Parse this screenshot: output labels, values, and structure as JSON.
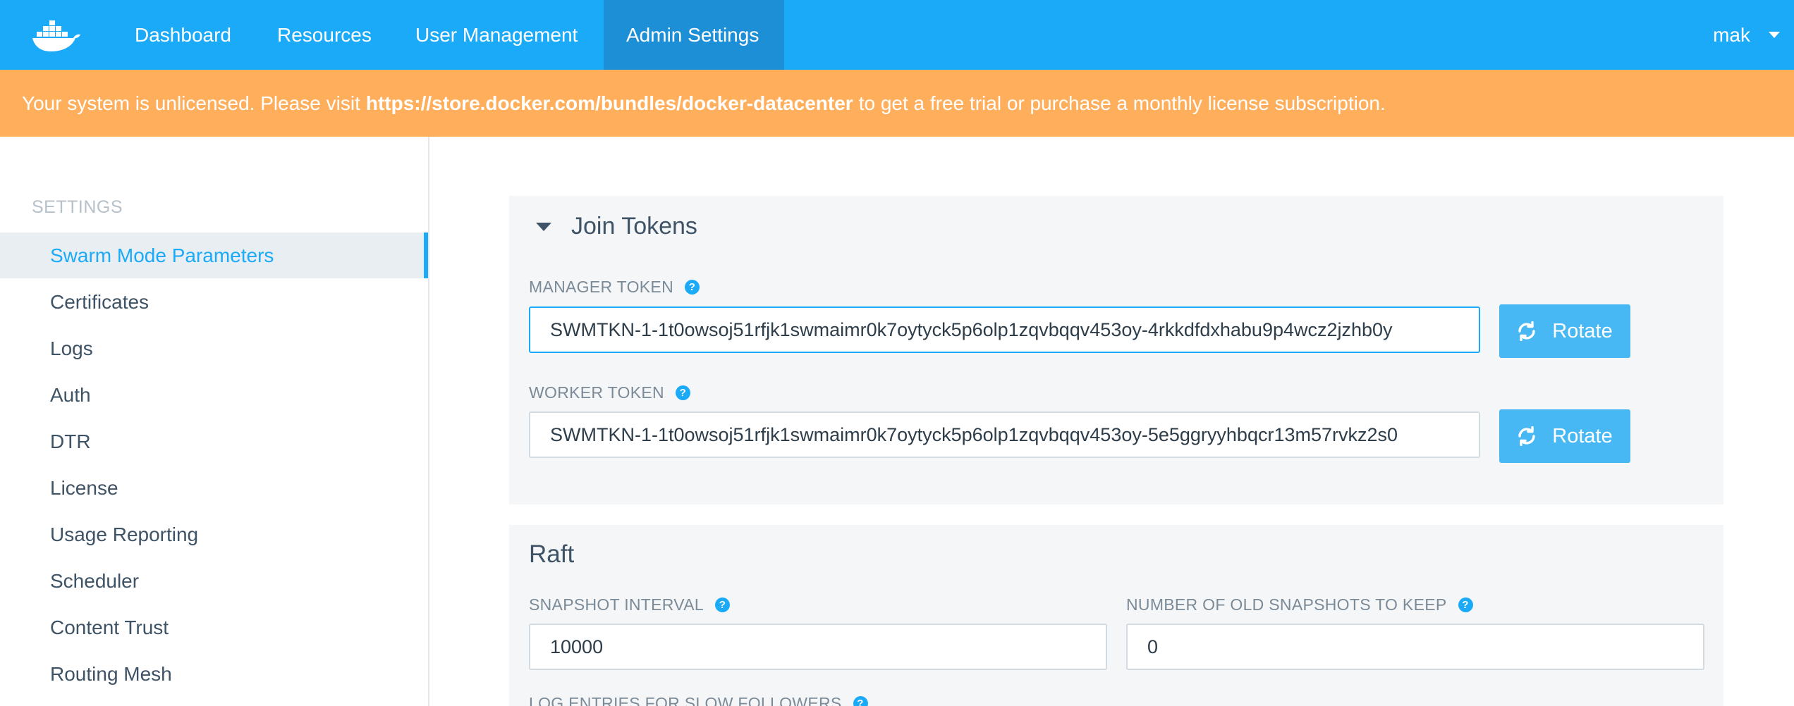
{
  "nav": {
    "logo_icon": "docker-whale-icon",
    "items": [
      {
        "label": "Dashboard"
      },
      {
        "label": "Resources"
      },
      {
        "label": "User Management"
      },
      {
        "label": "Admin Settings",
        "active": true
      }
    ],
    "user": "mak"
  },
  "banner": {
    "prefix": "Your system is unlicensed. Please visit",
    "link": "https://store.docker.com/bundles/docker-datacenter",
    "suffix": "to get a free trial or purchase a monthly license subscription."
  },
  "sidebar": {
    "heading": "SETTINGS",
    "items": [
      {
        "label": "Swarm Mode Parameters",
        "active": true
      },
      {
        "label": "Certificates"
      },
      {
        "label": "Logs"
      },
      {
        "label": "Auth"
      },
      {
        "label": "DTR"
      },
      {
        "label": "License"
      },
      {
        "label": "Usage Reporting"
      },
      {
        "label": "Scheduler"
      },
      {
        "label": "Content Trust"
      },
      {
        "label": "Routing Mesh"
      }
    ]
  },
  "join_tokens": {
    "title": "Join Tokens",
    "manager": {
      "label": "MANAGER TOKEN",
      "value": "SWMTKN-1-1t0owsoj51rfjk1swmaimr0k7oytyck5p6olp1zqvbqqv453oy-4rkkdfdxhabu9p4wcz2jzhb0y",
      "button": "Rotate"
    },
    "worker": {
      "label": "WORKER TOKEN",
      "value": "SWMTKN-1-1t0owsoj51rfjk1swmaimr0k7oytyck5p6olp1zqvbqqv453oy-5e5ggryyhbqcr13m57rvkz2s0",
      "button": "Rotate"
    }
  },
  "raft": {
    "title": "Raft",
    "snapshot_interval": {
      "label": "SNAPSHOT INTERVAL",
      "value": "10000"
    },
    "old_snapshots": {
      "label": "NUMBER OF OLD SNAPSHOTS TO KEEP",
      "value": "0"
    },
    "log_entries": {
      "label": "LOG ENTRIES FOR SLOW FOLLOWERS"
    }
  },
  "colors": {
    "nav_bg": "#1aaaf8",
    "nav_active": "#1d8fd6",
    "banner_bg": "#ffae5c",
    "accent": "#1aaaf8",
    "button_bg": "#48b8f5"
  },
  "help_glyph": "?"
}
